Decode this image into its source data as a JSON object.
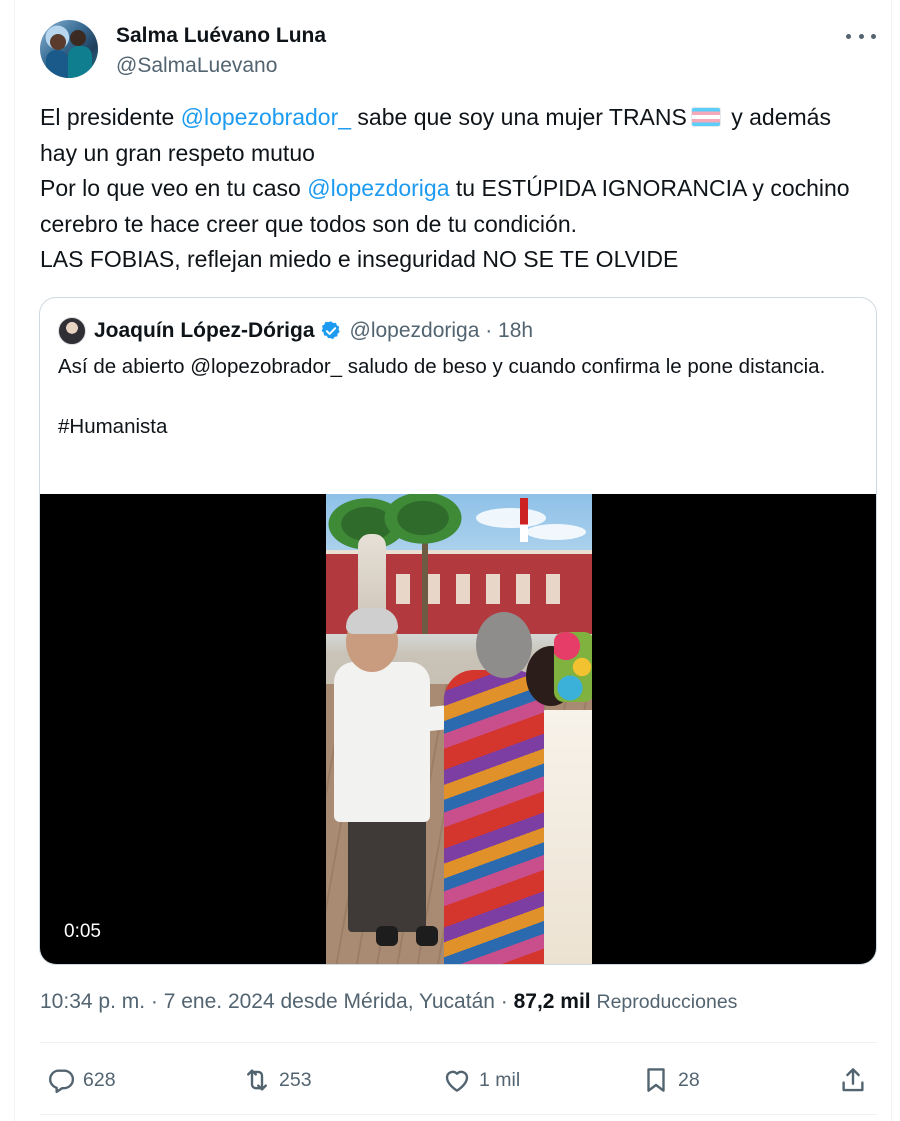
{
  "author": {
    "display_name": "Salma Luévano Luna",
    "handle": "@SalmaLuevano"
  },
  "tweet": {
    "text": {
      "p1": "El presidente ",
      "mention1": "@lopezobrador_",
      "p2": " sabe que soy una mujer TRANS",
      "p3": " y además hay un gran respeto mutuo",
      "p4": " Por lo que veo en tu caso ",
      "mention2": "@lopezdoriga",
      "p5": " tu ESTÚPIDA IGNORANCIA y cochino cerebro te hace creer que todos son de tu condición.",
      "p6": " LAS FOBIAS, reflejan miedo e inseguridad NO SE TE OLVIDE"
    },
    "emoji": "transgender-flag"
  },
  "quoted_tweet": {
    "display_name": "Joaquín López-Dóriga",
    "verified": true,
    "handle_time": "@lopezdoriga · 18h",
    "text": "Así de abierto @lopezobrador_ saludo de beso y cuando confirma le pone distancia.\n\n#Humanista",
    "video": {
      "timestamp": "0:05"
    }
  },
  "meta": {
    "time_location": "10:34 p. m. · 7 ene. 2024 desde Mérida, Yucatán · ",
    "views_count": "87,2 mil",
    "views_label": "Reproducciones"
  },
  "actions": {
    "replies": "628",
    "retweets": "253",
    "likes": "1 mil",
    "bookmarks": "28"
  },
  "colors": {
    "link": "#1d9bf0",
    "text": "#0f1419",
    "secondary": "#536471",
    "border": "#cfd9de"
  }
}
